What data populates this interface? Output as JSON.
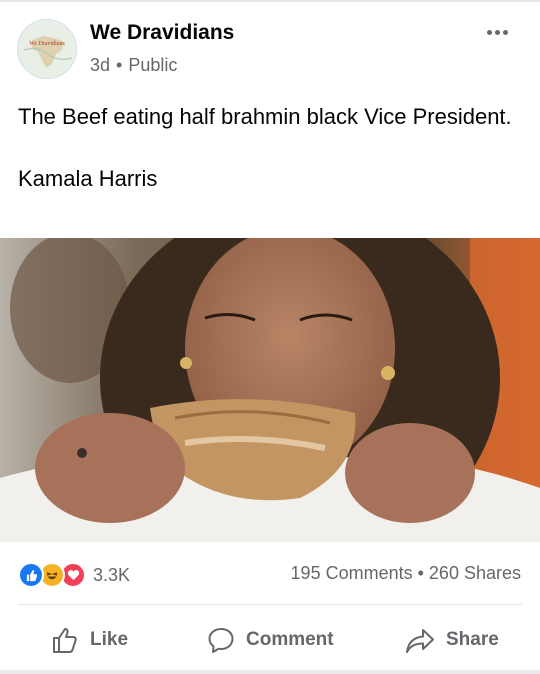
{
  "post": {
    "page_name": "We Dravidians",
    "avatar_text": "We Dravidians",
    "time": "3d",
    "separator": "•",
    "visibility": "Public",
    "more_icon": "more-horizontal-icon",
    "caption_line1": "The Beef eating half brahmin black Vice President.",
    "caption_line2": "Kamala Harris"
  },
  "stats": {
    "reaction_icons": [
      "like-reaction-icon",
      "haha-reaction-icon",
      "love-reaction-icon"
    ],
    "reaction_count": "3.3K",
    "comments": "195 Comments",
    "separator": "•",
    "shares": "260 Shares"
  },
  "actions": {
    "like": "Like",
    "comment": "Comment",
    "share": "Share"
  },
  "colors": {
    "text": "#050505",
    "secondary": "#65676b",
    "like_blue": "#1877f2",
    "haha_yellow": "#f7b125",
    "love_red": "#f33e58"
  }
}
